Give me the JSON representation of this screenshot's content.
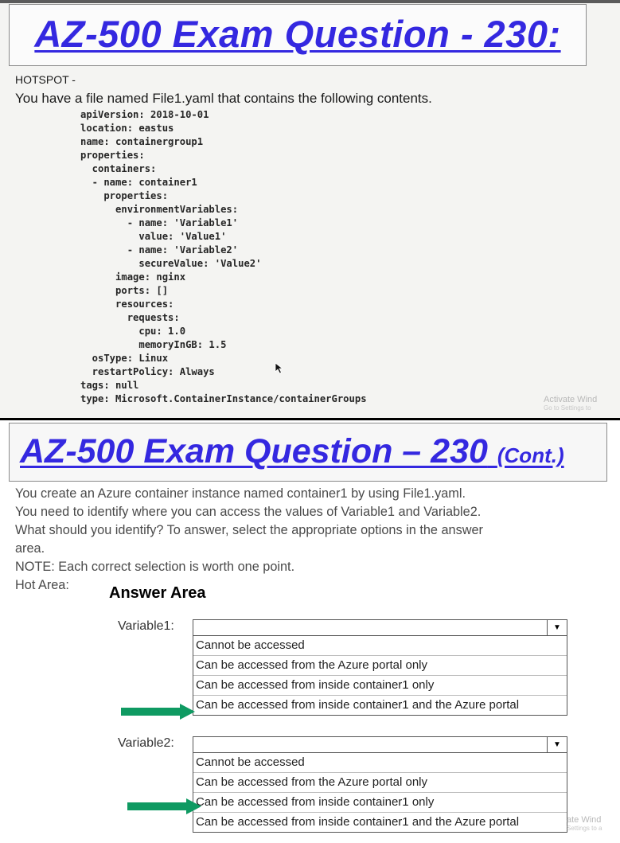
{
  "slide1": {
    "title": "AZ-500 Exam Question - 230:",
    "type_label": "HOTSPOT -",
    "intro": "You have a file named File1.yaml that contains the following contents.",
    "code": [
      "apiVersion: 2018-10-01",
      "location: eastus",
      "name: containergroup1",
      "properties:",
      "  containers:",
      "  - name: container1",
      "    properties:",
      "      environmentVariables:",
      "        - name: 'Variable1'",
      "          value: 'Value1'",
      "        - name: 'Variable2'",
      "          secureValue: 'Value2'",
      "      image: nginx",
      "      ports: []",
      "      resources:",
      "        requests:",
      "          cpu: 1.0",
      "          memoryInGB: 1.5",
      "  osType: Linux",
      "  restartPolicy: Always",
      "tags: null",
      "type: Microsoft.ContainerInstance/containerGroups"
    ],
    "watermark": "Activate Wind",
    "watermark_sub": "Go to Settings to"
  },
  "slide2": {
    "title": "AZ-500 Exam Question – 230",
    "title_suffix": "(Cont.)",
    "lines": [
      "You create an Azure container instance named container1 by using File1.yaml.",
      "You need to identify where you can access the values of Variable1 and Variable2.",
      "What should you identify? To answer, select the appropriate options in the answer",
      "area.",
      "NOTE: Each correct selection is worth one point."
    ],
    "hot_area_label": "Hot Area:",
    "answer_area_title": "Answer Area",
    "variable1": {
      "label": "Variable1:",
      "dropdown_icon": "▼",
      "options": [
        "Cannot be accessed",
        "Can be accessed from the Azure portal only",
        "Can be accessed from inside container1 only",
        "Can be accessed from inside container1 and the Azure portal"
      ],
      "marked_option_index": 3
    },
    "variable2": {
      "label": "Variable2:",
      "dropdown_icon": "▼",
      "options": [
        "Cannot be accessed",
        "Can be accessed from the Azure portal only",
        "Can be accessed from inside container1 only",
        "Can be accessed from inside container1 and the Azure portal"
      ],
      "marked_option_index": 2
    },
    "watermark": "ate Wind",
    "watermark_sub": "Settings to a"
  },
  "colors": {
    "title": "#3428e0",
    "arrow": "#0f9a62"
  }
}
